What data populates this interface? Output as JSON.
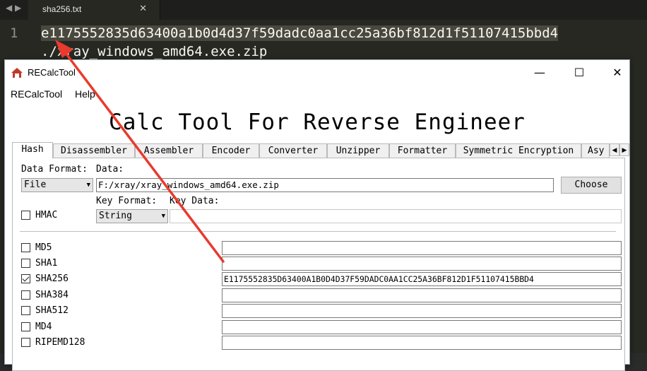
{
  "editor": {
    "tab_title": "sha256.txt",
    "line_number": "1",
    "line1": "e1175552835d63400a1b0d4d37f59dadc0aa1cc25a36bf812d1f51107415bbd4",
    "line2": "./xray_windows_amd64.exe.zip"
  },
  "window": {
    "title": "RECalcTool",
    "minimize": "—",
    "maximize": "☐",
    "close": "✕"
  },
  "menu": [
    "RECalcTool",
    "Help"
  ],
  "heading": "Calc Tool For Reverse Engineer",
  "tabs": [
    "Hash",
    "Disassembler",
    "Assembler",
    "Encoder",
    "Converter",
    "Unzipper",
    "Formatter",
    "Symmetric Encryption",
    "Asy"
  ],
  "hash": {
    "data_format_label": "Data Format:",
    "data_format_value": "File",
    "data_label": "Data:",
    "data_value": "F:/xray/xray_windows_amd64.exe.zip",
    "choose_button": "Choose",
    "hmac_label": "HMAC",
    "key_format_label": "Key Format:",
    "key_format_value": "String",
    "key_data_label": "Key Data:",
    "algorithms": [
      {
        "name": "MD5",
        "checked": false,
        "value": ""
      },
      {
        "name": "SHA1",
        "checked": false,
        "value": ""
      },
      {
        "name": "SHA256",
        "checked": true,
        "value": "E1175552835D63400A1B0D4D37F59DADC0AA1CC25A36BF812D1F51107415BBD4"
      },
      {
        "name": "SHA384",
        "checked": false,
        "value": ""
      },
      {
        "name": "SHA512",
        "checked": false,
        "value": ""
      },
      {
        "name": "MD4",
        "checked": false,
        "value": ""
      },
      {
        "name": "RIPEMD128",
        "checked": false,
        "value": ""
      }
    ]
  },
  "colors": {
    "annotation_arrow": "#e83a2e",
    "editor_bg": "#272822"
  }
}
